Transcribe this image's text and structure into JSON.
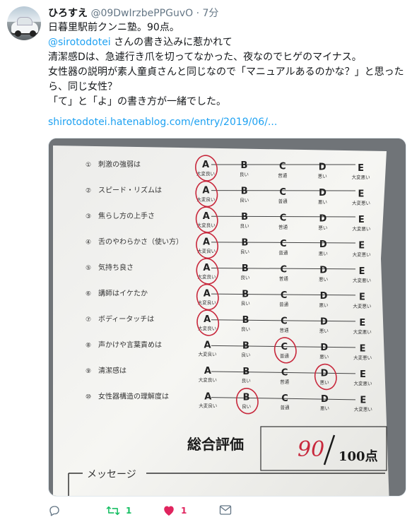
{
  "tweet": {
    "author_name": "ひろすえ",
    "author_handle": "@09DwIrzbePPGuvO",
    "separator": "·",
    "time": "7分",
    "text_lines": [
      "日暮里駅前クンニ塾。90点。",
      "@sirotodotei さんの書き込みに惹かれて",
      "清潔感Dは、急遽行き爪を切ってなかった、夜なのでヒゲのマイナス。",
      "女性器の説明が素人童貞さんと同じなので「マニュアルあるのかな？」と思ったら、同じ女性？",
      "「て」と「よ」の書き方が一緒でした。"
    ],
    "mention": "@sirotodotei",
    "mention_rest": " さんの書き込みに惹かれて",
    "link": "shirotodotei.hatenablog.com/entry/2019/06/..."
  },
  "sheet": {
    "items": [
      {
        "num": "①",
        "label": "刺激の強弱は",
        "circled": "A"
      },
      {
        "num": "②",
        "label": "スピード・リズムは",
        "circled": "A"
      },
      {
        "num": "③",
        "label": "焦らし方の上手さ",
        "circled": "A"
      },
      {
        "num": "④",
        "label": "舌のやわらかさ（使い方）",
        "circled": "A"
      },
      {
        "num": "⑤",
        "label": "気持ち良さ",
        "circled": "A"
      },
      {
        "num": "⑥",
        "label": "講師はイケたか",
        "circled": "A"
      },
      {
        "num": "⑦",
        "label": "ボディータッチは",
        "circled": "A"
      },
      {
        "num": "⑧",
        "label": "声かけや言葉責めは",
        "circled": "C"
      },
      {
        "num": "⑨",
        "label": "清潔感は",
        "circled": "D"
      },
      {
        "num": "⑩",
        "label": "女性器構造の理解度は",
        "circled": "B"
      }
    ],
    "grades": [
      "A",
      "B",
      "C",
      "D",
      "E"
    ],
    "grade_labels": [
      "大変良い",
      "良い",
      "普通",
      "悪い",
      "大変悪い"
    ],
    "total_label": "総合評価",
    "score": "90",
    "max_score": "100点",
    "message_label": "メッセージ"
  },
  "actions": {
    "reply_count": "",
    "retweet_count": "1",
    "like_count": "1"
  },
  "colors": {
    "link": "#1da1f2",
    "retweet": "#17bf63",
    "like": "#e0245e",
    "muted": "#657786",
    "pen": "#c8283c"
  }
}
